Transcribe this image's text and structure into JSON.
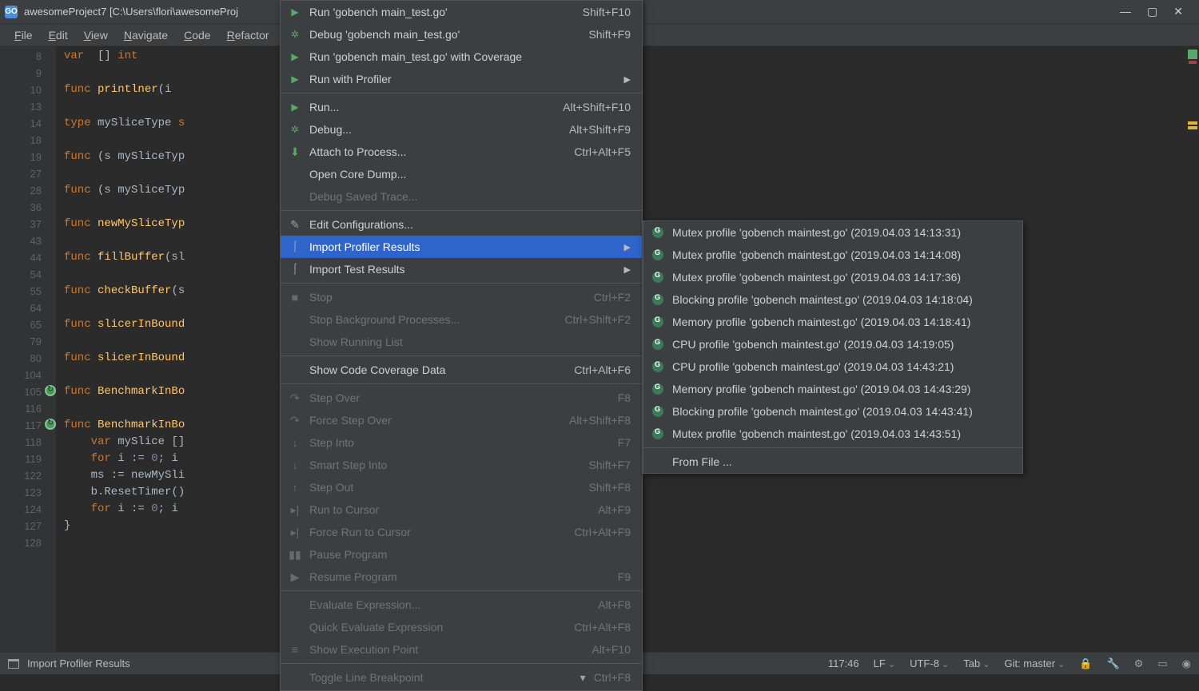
{
  "window": {
    "title": "awesomeProject7 [C:\\Users\\flori\\awesomeProj",
    "app_icon_letter": "GO"
  },
  "menubar": [
    "File",
    "Edit",
    "View",
    "Navigate",
    "Code",
    "Refactor"
  ],
  "gutter_lines": [
    "8",
    "9",
    "10",
    "13",
    "14",
    "18",
    "19",
    "27",
    "28",
    "36",
    "37",
    "43",
    "44",
    "54",
    "55",
    "64",
    "65",
    "79",
    "80",
    "104",
    "105",
    "116",
    "117",
    "118",
    "119",
    "122",
    "123",
    "124",
    "127",
    "128"
  ],
  "code_lines": [
    {
      "html": "<span class='kw'>var</span>  [] <span class='kw'>int</span>"
    },
    {
      "html": ""
    },
    {
      "html": "<span class='kw'>func</span> <span class='fn'>printlner</span>(i"
    },
    {
      "html": ""
    },
    {
      "html": "<span class='kw'>type</span> <span class='ty'>mySliceType</span> <span class='kw'>s</span>"
    },
    {
      "html": ""
    },
    {
      "html": "<span class='kw'>func</span> (s mySliceTyp"
    },
    {
      "html": ""
    },
    {
      "html": "<span class='kw'>func</span> (s mySliceTyp"
    },
    {
      "html": ""
    },
    {
      "html": "<span class='kw'>func</span> <span class='fn'>newMySliceTyp</span>"
    },
    {
      "html": ""
    },
    {
      "html": "<span class='kw'>func</span> <span class='fn'>fillBuffer</span>(sl"
    },
    {
      "html": ""
    },
    {
      "html": "<span class='kw'>func</span> <span class='fn'>checkBuffer</span>(s"
    },
    {
      "html": ""
    },
    {
      "html": "<span class='kw'>func</span> <span class='fn'>slicerInBound</span>"
    },
    {
      "html": ""
    },
    {
      "html": "<span class='kw'>func</span> <span class='fn'>slicerInBound</span>"
    },
    {
      "html": ""
    },
    {
      "html": "<span class='kw'>func</span> <span class='fn'>BenchmarkInBo</span>"
    },
    {
      "html": ""
    },
    {
      "html": "<span class='kw'>func</span> <span class='fn'>BenchmarkInBo</span>"
    },
    {
      "html": "    <span class='kw'>var</span> mySlice []"
    },
    {
      "html": "    <span class='kw'>for</span> i := <span class='ident'>0</span>; i"
    },
    {
      "html": "    ms := newMySli"
    },
    {
      "html": "    b.ResetTimer()"
    },
    {
      "html": "    <span class='kw'>for</span> i := <span class='ident'>0</span>; i"
    },
    {
      "html": "}"
    },
    {
      "html": ""
    }
  ],
  "run_menu": {
    "items": [
      {
        "icon": "run",
        "label": "Run 'gobench main_test.go'",
        "shortcut": "Shift+F10"
      },
      {
        "icon": "bug",
        "label": "Debug 'gobench main_test.go'",
        "shortcut": "Shift+F9"
      },
      {
        "icon": "run-cov",
        "label": "Run 'gobench main_test.go' with Coverage",
        "shortcut": ""
      },
      {
        "icon": "run",
        "label": "Run with Profiler",
        "shortcut": "",
        "arrow": true
      },
      {
        "sep": true
      },
      {
        "icon": "run",
        "label": "Run...",
        "shortcut": "Alt+Shift+F10"
      },
      {
        "icon": "bug",
        "label": "Debug...",
        "shortcut": "Alt+Shift+F9"
      },
      {
        "icon": "attach",
        "label": "Attach to Process...",
        "shortcut": "Ctrl+Alt+F5"
      },
      {
        "icon": "",
        "label": "Open Core Dump...",
        "shortcut": ""
      },
      {
        "icon": "",
        "label": "Debug Saved Trace...",
        "shortcut": "",
        "disabled": true
      },
      {
        "sep": true
      },
      {
        "icon": "edit",
        "label": "Edit Configurations...",
        "shortcut": ""
      },
      {
        "icon": "chart",
        "label": "Import Profiler Results",
        "shortcut": "",
        "arrow": true,
        "highlighted": true,
        "name": "import-profiler-results"
      },
      {
        "icon": "chart",
        "label": "Import Test Results",
        "shortcut": "",
        "arrow": true
      },
      {
        "sep": true
      },
      {
        "icon": "stop",
        "label": "Stop",
        "shortcut": "Ctrl+F2",
        "disabled": true
      },
      {
        "icon": "",
        "label": "Stop Background Processes...",
        "shortcut": "Ctrl+Shift+F2",
        "disabled": true
      },
      {
        "icon": "",
        "label": "Show Running List",
        "shortcut": "",
        "disabled": true
      },
      {
        "sep": true
      },
      {
        "icon": "",
        "label": "Show Code Coverage Data",
        "shortcut": "Ctrl+Alt+F6"
      },
      {
        "sep": true
      },
      {
        "icon": "step-over",
        "label": "Step Over",
        "shortcut": "F8",
        "disabled": true
      },
      {
        "icon": "step-over-f",
        "label": "Force Step Over",
        "shortcut": "Alt+Shift+F8",
        "disabled": true
      },
      {
        "icon": "step-into",
        "label": "Step Into",
        "shortcut": "F7",
        "disabled": true
      },
      {
        "icon": "step-into-s",
        "label": "Smart Step Into",
        "shortcut": "Shift+F7",
        "disabled": true
      },
      {
        "icon": "step-out",
        "label": "Step Out",
        "shortcut": "Shift+F8",
        "disabled": true
      },
      {
        "icon": "cursor",
        "label": "Run to Cursor",
        "shortcut": "Alt+F9",
        "disabled": true
      },
      {
        "icon": "cursor-f",
        "label": "Force Run to Cursor",
        "shortcut": "Ctrl+Alt+F9",
        "disabled": true
      },
      {
        "icon": "pause",
        "label": "Pause Program",
        "shortcut": "",
        "disabled": true
      },
      {
        "icon": "resume",
        "label": "Resume Program",
        "shortcut": "F9",
        "disabled": true
      },
      {
        "sep": true
      },
      {
        "icon": "",
        "label": "Evaluate Expression...",
        "shortcut": "Alt+F8",
        "disabled": true
      },
      {
        "icon": "",
        "label": "Quick Evaluate Expression",
        "shortcut": "Ctrl+Alt+F8",
        "disabled": true
      },
      {
        "icon": "exec",
        "label": "Show Execution Point",
        "shortcut": "Alt+F10",
        "disabled": true
      },
      {
        "sep": true
      },
      {
        "icon": "",
        "label": "Toggle Line Breakpoint",
        "shortcut": "Ctrl+F8",
        "disabled": true,
        "dropdown": true
      }
    ]
  },
  "submenu": {
    "items": [
      {
        "label": "Mutex profile 'gobench maintest.go' (2019.04.03 14:13:31)"
      },
      {
        "label": "Mutex profile 'gobench maintest.go' (2019.04.03 14:14:08)"
      },
      {
        "label": "Mutex profile 'gobench maintest.go' (2019.04.03 14:17:36)"
      },
      {
        "label": "Blocking profile 'gobench maintest.go' (2019.04.03 14:18:04)"
      },
      {
        "label": "Memory profile 'gobench maintest.go' (2019.04.03 14:18:41)"
      },
      {
        "label": "CPU profile 'gobench maintest.go' (2019.04.03 14:19:05)"
      },
      {
        "label": "CPU profile 'gobench maintest.go' (2019.04.03 14:43:21)"
      },
      {
        "label": "Memory profile 'gobench maintest.go' (2019.04.03 14:43:29)"
      },
      {
        "label": "Blocking profile 'gobench maintest.go' (2019.04.03 14:43:41)"
      },
      {
        "label": "Mutex profile 'gobench maintest.go' (2019.04.03 14:43:51)"
      }
    ],
    "from_file": "From File ..."
  },
  "statusbar": {
    "left": "Import Profiler Results",
    "position": "117:46",
    "line_ending": "LF",
    "encoding": "UTF-8",
    "indent": "Tab",
    "git": "Git: master"
  }
}
